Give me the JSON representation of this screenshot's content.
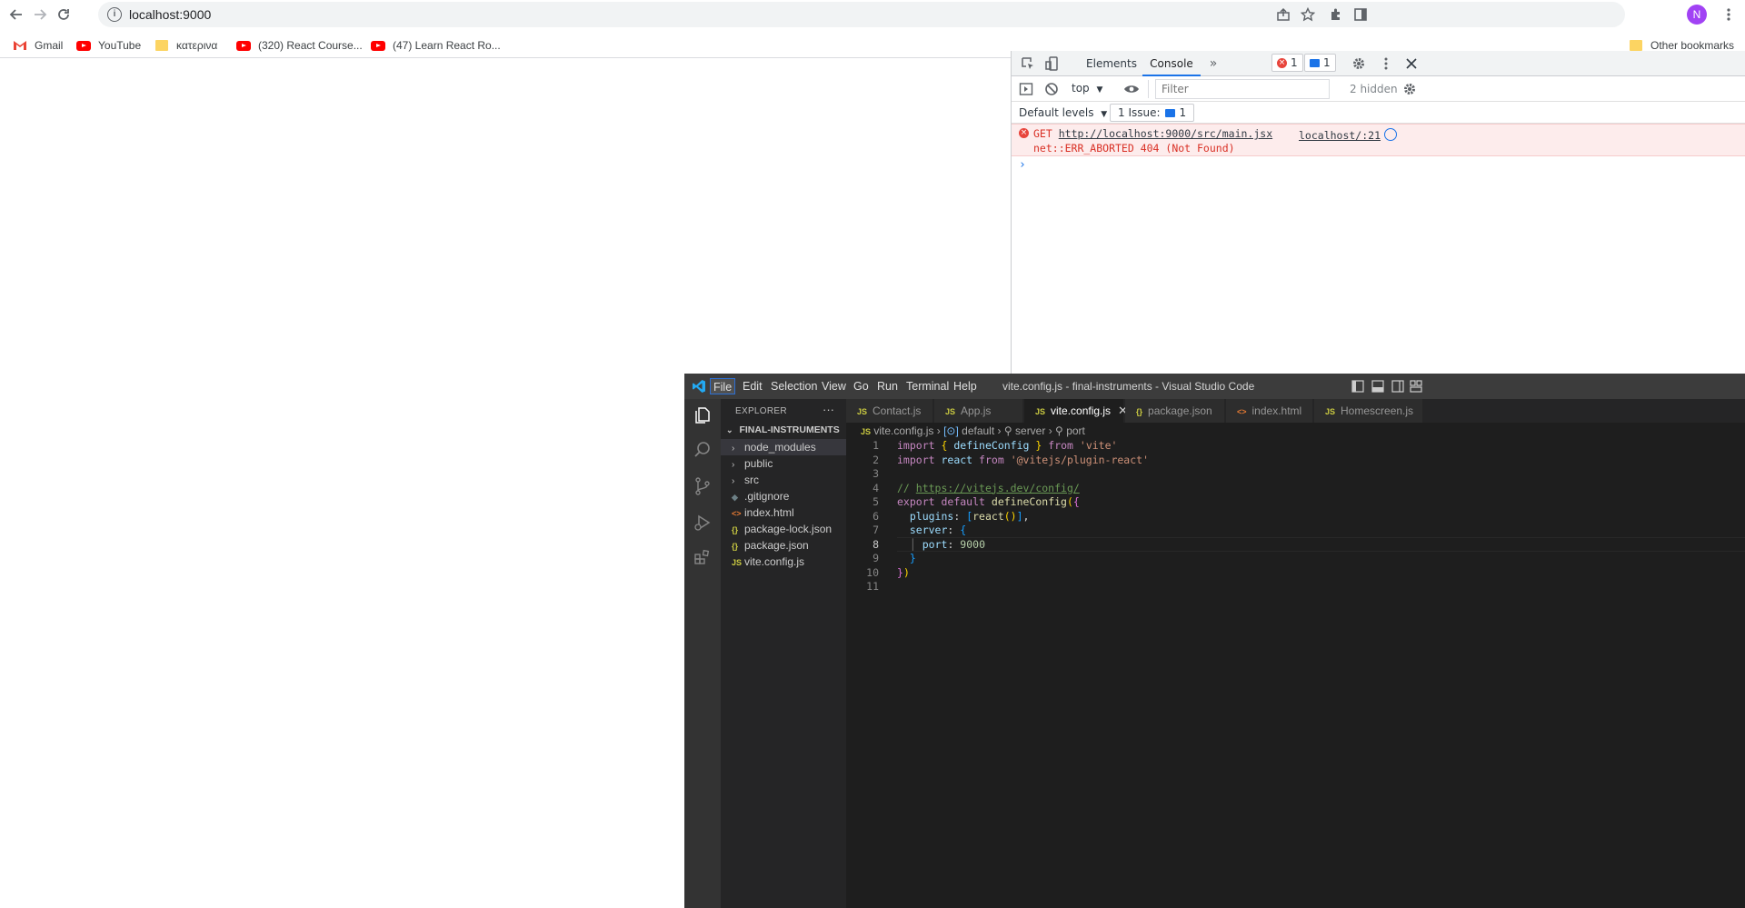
{
  "browser": {
    "url": "localhost:9000",
    "avatar_letter": "N",
    "bookmarks": [
      {
        "label": "Gmail"
      },
      {
        "label": "YouTube"
      },
      {
        "label": "κατερινα"
      },
      {
        "label": "(320) React Course..."
      },
      {
        "label": "(47) Learn React Ro..."
      }
    ],
    "other_bookmarks": "Other bookmarks"
  },
  "devtools": {
    "tabs": {
      "elements": "Elements",
      "console": "Console"
    },
    "error_count": "1",
    "message_count": "1",
    "context": "top",
    "filter_placeholder": "Filter",
    "hidden_count": "2 hidden",
    "levels": "Default levels",
    "issues_label": "1 Issue:",
    "issues_count": "1",
    "error": {
      "method": "GET",
      "url": "http://localhost:9000/src/main.jsx",
      "detail": "net::ERR_ABORTED 404 (Not Found)",
      "source": "localhost/:21"
    }
  },
  "vscode": {
    "window_title": "vite.config.js - final-instruments - Visual Studio Code",
    "menus": [
      "File",
      "Edit",
      "Selection",
      "View",
      "Go",
      "Run",
      "Terminal",
      "Help"
    ],
    "explorer_title": "EXPLORER",
    "project": "FINAL-INSTRUMENTS",
    "tree": [
      {
        "name": "node_modules",
        "kind": "folder"
      },
      {
        "name": "public",
        "kind": "folder"
      },
      {
        "name": "src",
        "kind": "folder"
      },
      {
        "name": ".gitignore",
        "kind": "git"
      },
      {
        "name": "index.html",
        "kind": "html"
      },
      {
        "name": "package-lock.json",
        "kind": "json"
      },
      {
        "name": "package.json",
        "kind": "json"
      },
      {
        "name": "vite.config.js",
        "kind": "js"
      }
    ],
    "tabs": [
      {
        "name": "Contact.js",
        "kind": "js"
      },
      {
        "name": "App.js",
        "kind": "js"
      },
      {
        "name": "vite.config.js",
        "kind": "js",
        "active": true
      },
      {
        "name": "package.json",
        "kind": "json"
      },
      {
        "name": "index.html",
        "kind": "html"
      },
      {
        "name": "Homescreen.js",
        "kind": "js"
      }
    ],
    "breadcrumb": [
      "vite.config.js",
      "default",
      "server",
      "port"
    ],
    "line_numbers": [
      "1",
      "2",
      "3",
      "4",
      "5",
      "6",
      "7",
      "8",
      "9",
      "10",
      "11"
    ],
    "code": {
      "l1_kw1": "import",
      "l1_name": "defineConfig",
      "l1_kw2": "from",
      "l1_str": "'vite'",
      "l2_kw1": "import",
      "l2_name": "react",
      "l2_kw2": "from",
      "l2_str": "'@vitejs/plugin-react'",
      "l4_cmt": "// ",
      "l4_link": "https://vitejs.dev/config/",
      "l5_kw1": "export",
      "l5_kw2": "default",
      "l5_fn": "defineConfig",
      "l6_prop": "plugins",
      "l6_fn": "react",
      "l7_prop": "server",
      "l8_prop": "port",
      "l8_num": "9000"
    }
  }
}
